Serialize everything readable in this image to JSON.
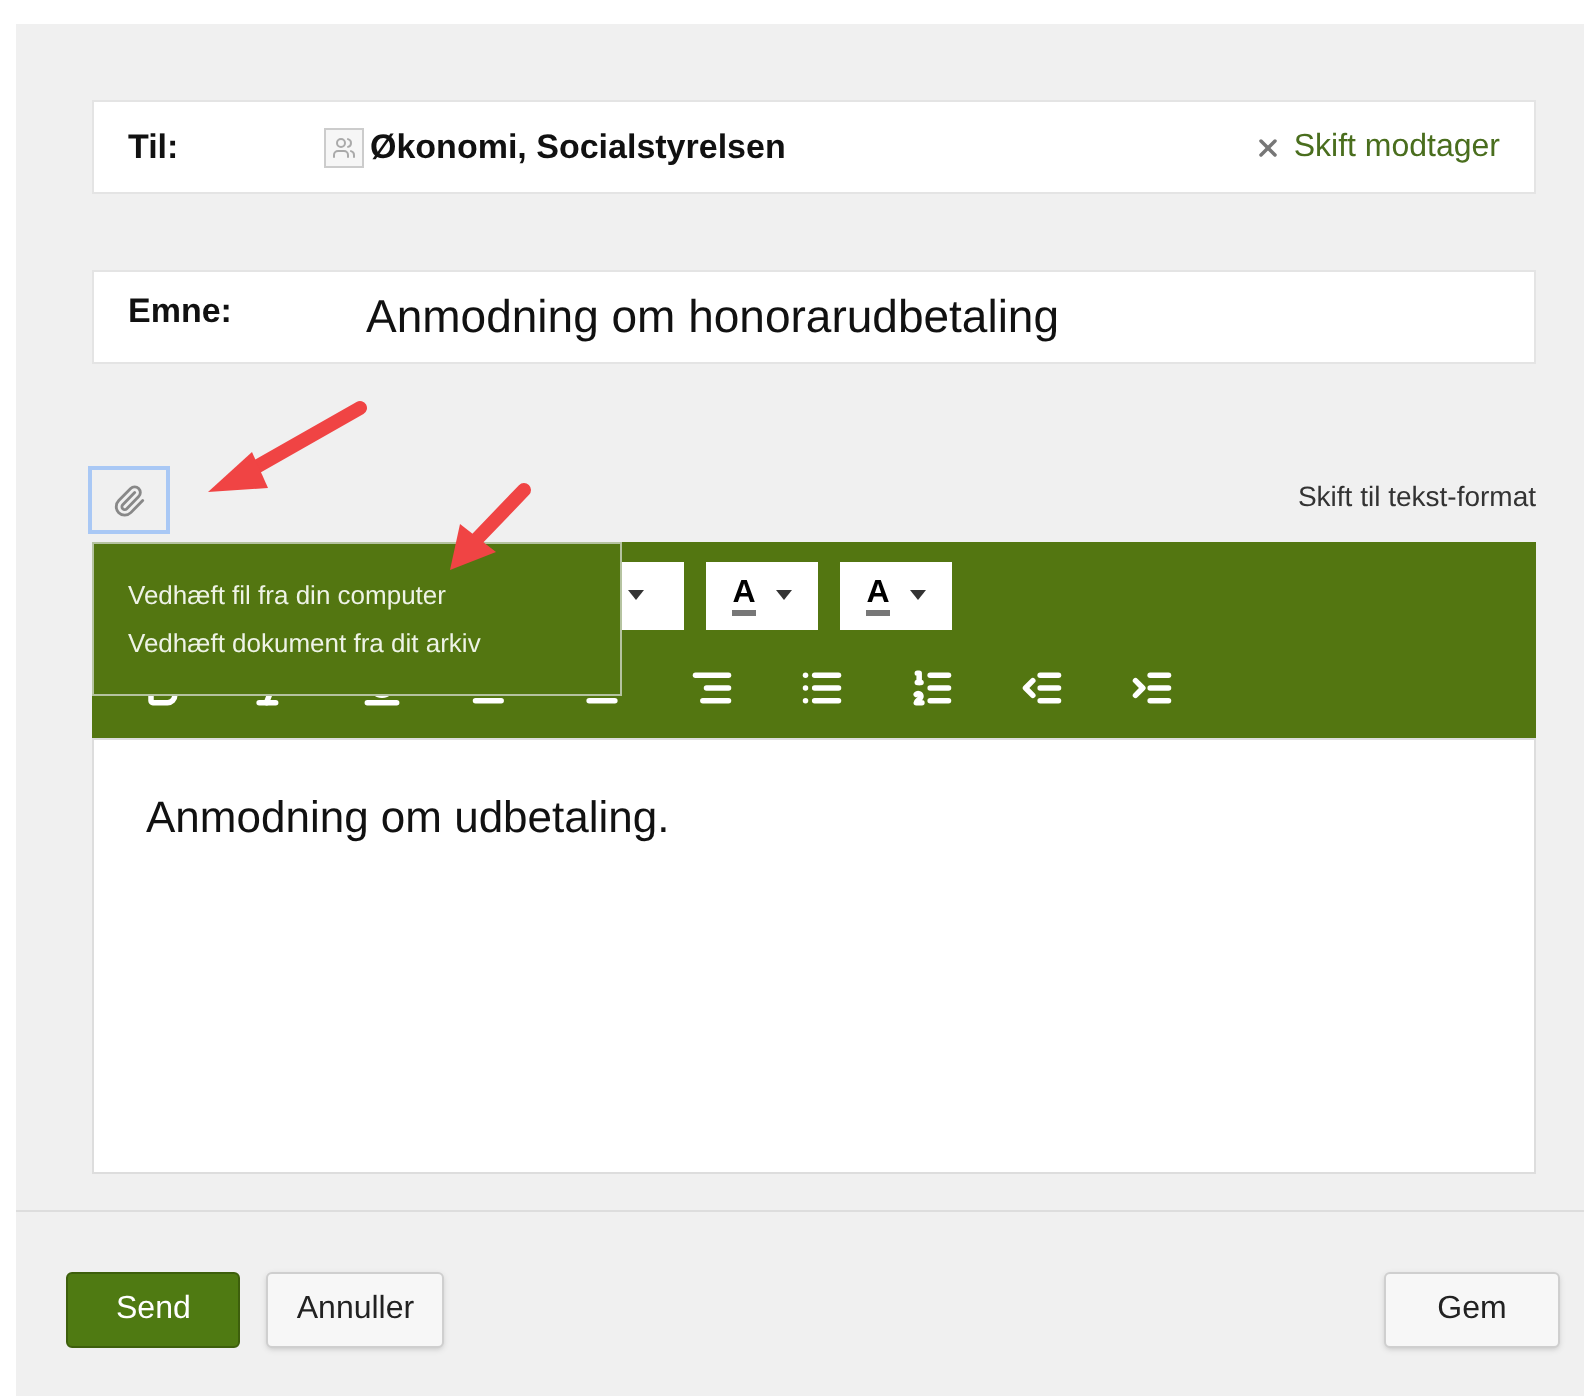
{
  "recipient": {
    "label": "Til:",
    "value": "Økonomi, Socialstyrelsen",
    "change_link": "Skift modtager"
  },
  "subject": {
    "label": "Emne:",
    "value": "Anmodning om honorarudbetaling"
  },
  "attach_menu": {
    "expanded": true,
    "items": [
      "Vedhæft fil fra din computer",
      "Vedhæft dokument fra dit arkiv"
    ]
  },
  "format_toggle": "Skift til tekst-format",
  "toolbar": {
    "color_buttons": [
      "A",
      "A"
    ]
  },
  "editor": {
    "text": "Anmodning om udbetaling."
  },
  "buttons": [
    {
      "label": "Send",
      "kind": "primary"
    },
    {
      "label": "Annuller",
      "kind": "secondary"
    },
    {
      "label": "Gem",
      "kind": "secondary"
    }
  ]
}
